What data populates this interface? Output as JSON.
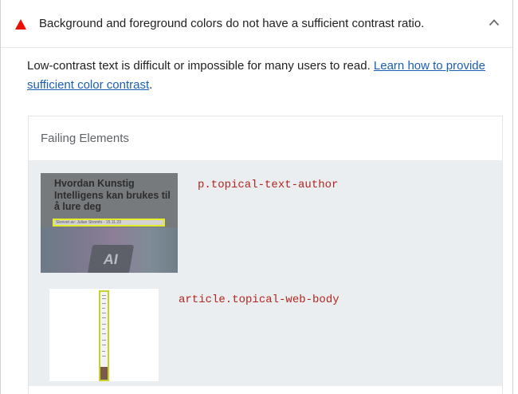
{
  "audit": {
    "title": "Background and foreground colors do not have a sufficient contrast ratio.",
    "status_icon": "fail-triangle-icon",
    "status_color": "#eb0f00",
    "expand_icon": "chevron-up-icon",
    "description": "Low-contrast text is difficult or impossible for many users to read.",
    "description_after_link": ".",
    "learn_more_link": "Learn how to provide sufficient color contrast",
    "link_color": "#1a5fb4"
  },
  "details": {
    "header": "Failing Elements",
    "items": [
      {
        "selector": "p.topical-text-author",
        "thumbnail": {
          "headline": "Hvordan Kunstig Intelligens kan brukes til å lure deg",
          "author_text": "Skrevet av: Julian Stromfo - 15.11.23",
          "badge": "AI"
        }
      },
      {
        "selector": "article.topical-web-body"
      }
    ],
    "highlight_color": "#e4ec2a",
    "selector_color": "#b3261e"
  }
}
